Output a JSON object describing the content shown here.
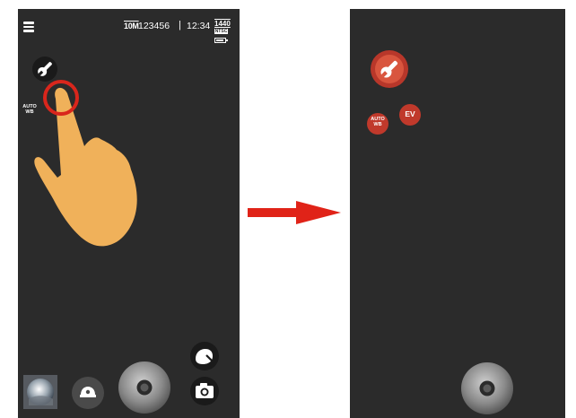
{
  "status": {
    "quality": "10M",
    "shots_remaining": "123456",
    "separator": "|",
    "time": "12:34",
    "resolution": "1440",
    "format": "NTSC"
  },
  "left_screen": {
    "settings_button_icon": "wrench-icon",
    "wb_label_line1": "AUTO",
    "wb_label_line2": "WB"
  },
  "right_screen": {
    "wb_label_line1": "AUTO",
    "wb_label_line2": "WB",
    "ev_label": "EV"
  },
  "colors": {
    "screen_bg": "#2b2b2b",
    "accent_red": "#c9412f",
    "highlight_ring": "#d9261c",
    "hand": "#f0b15a",
    "arrow": "#e02318"
  }
}
